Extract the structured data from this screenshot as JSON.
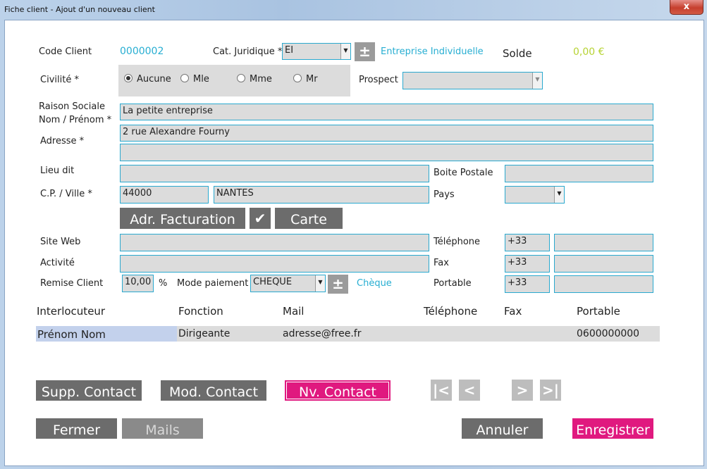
{
  "window": {
    "title": "Fiche client - Ajout d'un nouveau client",
    "close_glyph": "x"
  },
  "client": {
    "code_label": "Code Client",
    "code_value": "0000002",
    "cat_label": "Cat. Juridique *",
    "cat_value": "EI",
    "cat_desc": "Entreprise Individuelle",
    "solde_label": "Solde",
    "solde_value": "0,00 €",
    "civilite_label": "Civilité *",
    "civilite_options": [
      "Aucune",
      "Mle",
      "Mme",
      "Mr"
    ],
    "civilite_selected": "Aucune",
    "prospect_label": "Prospect",
    "prospect_value": "",
    "raison_label_1": "Raison Sociale",
    "raison_label_2": "Nom / Prénom *",
    "raison_value": "La petite entreprise",
    "adresse_label": "Adresse *",
    "adresse_1": "2 rue Alexandre Fourny",
    "adresse_2": "",
    "lieu_label": "Lieu dit",
    "lieu_value": "",
    "bp_label": "Boite Postale",
    "bp_value": "",
    "cp_label": "C.P. / Ville *",
    "cp_value": "44000",
    "ville_value": "NANTES",
    "pays_label": "Pays",
    "pays_value": "",
    "adr_fact_label": "Adr. Facturation",
    "check_glyph": "✔",
    "carte_label": "Carte",
    "site_label": "Site Web",
    "site_value": "",
    "tel_label": "Téléphone",
    "tel_prefix": "+33",
    "tel_value": "",
    "activite_label": "Activité",
    "activite_value": "",
    "fax_label": "Fax",
    "fax_prefix": "+33",
    "fax_value": "",
    "remise_label": "Remise Client",
    "remise_value": "10,00",
    "remise_unit": "%",
    "mode_label": "Mode paiement",
    "mode_value": "CHEQUE",
    "mode_desc": "Chèque",
    "portable_label": "Portable",
    "portable_prefix": "+33",
    "portable_value": "",
    "plus_glyph": "±",
    "arrow_glyph": "▼"
  },
  "contacts": {
    "headers": [
      "Interlocuteur",
      "Fonction",
      "Mail",
      "Téléphone",
      "Fax",
      "Portable"
    ],
    "rows": [
      {
        "interlocuteur": "Prénom Nom",
        "fonction": "Dirigeante",
        "mail": "adresse@free.fr",
        "telephone": "",
        "fax": "",
        "portable": "0600000000"
      }
    ]
  },
  "buttons": {
    "supp": "Supp. Contact",
    "mod": "Mod. Contact",
    "nv": "Nv. Contact",
    "first": "|<",
    "prev": "<",
    "next": ">",
    "last": ">|",
    "fermer": "Fermer",
    "mails": "Mails",
    "annuler": "Annuler",
    "enregistrer": "Enregistrer"
  },
  "colors": {
    "accent_cyan": "#27aed2",
    "pink": "#e0197f",
    "solde": "#b7d334"
  }
}
